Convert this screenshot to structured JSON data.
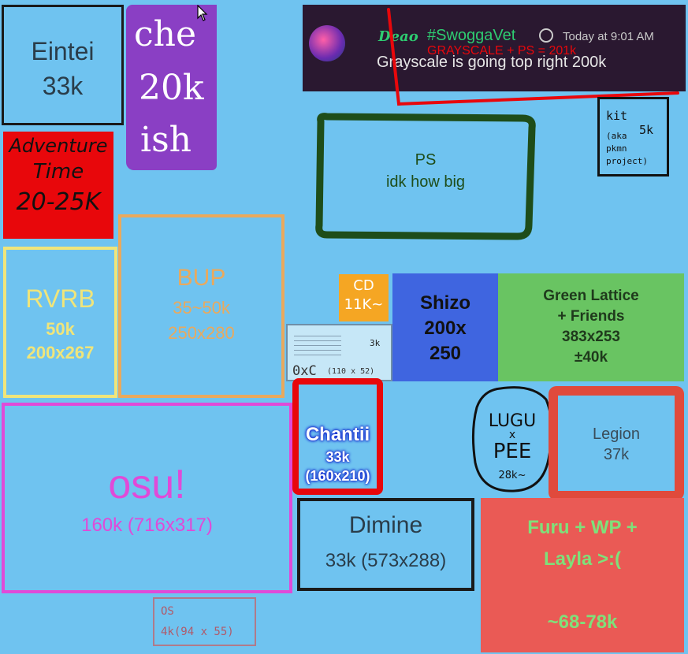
{
  "regions": {
    "eintei": {
      "name": "Eintei",
      "size": "33k"
    },
    "che": {
      "line1": "che",
      "line2": "20k",
      "line3": "ish"
    },
    "adventure": {
      "line1": "Adventure",
      "line2": "Time",
      "line3": "20-25K"
    },
    "rvrb": {
      "name": "RVRB",
      "size": "50k",
      "dims": "200x267"
    },
    "bup": {
      "name": "BUP",
      "size": "35~50k",
      "dims": "250x280"
    },
    "ps": {
      "line1": "PS",
      "line2": "idk how big"
    },
    "kit": {
      "name": "kit",
      "note1": "(aka",
      "note2": "pkmn",
      "note3": "project)",
      "size": "5k"
    },
    "cd": {
      "line1": "CD",
      "line2": "11K~"
    },
    "shizo": {
      "name": "Shizo",
      "dims1": "200x",
      "dims2": "250"
    },
    "green_lattice": {
      "line1": "Green Lattice",
      "line2": "+ Friends",
      "line3": "383x253",
      "line4": "±40k"
    },
    "oxc": {
      "name": "0xC",
      "dims": "(110 x 52)",
      "size": "3k"
    },
    "osu": {
      "name": "osu!",
      "detail": "160k (716x317)"
    },
    "chantii": {
      "name": "Chantii",
      "size": "33k",
      "dims": "(160x210)"
    },
    "lugu": {
      "line1": "LUGU",
      "line2": "x",
      "line3": "PEE",
      "line4": "28k~"
    },
    "legion": {
      "name": "Legion",
      "size": "37k"
    },
    "dimine": {
      "name": "Dimine",
      "detail": "33k (573x288)"
    },
    "furu": {
      "line1": "Furu + WP +",
      "line2": "Layla >:(",
      "line3": "~68-78k"
    },
    "os": {
      "name": "OS",
      "detail": "4k(94 x 55)"
    }
  },
  "message": {
    "username": "Deao",
    "channel": "#SwoggaVet",
    "timestamp": "Today at 9:01 AM",
    "text": "Grayscale is going top right 200k",
    "overlay": "GRAYSCALE + PS = 201k"
  },
  "colors": {
    "background": "#6fc3f0",
    "che": "#8a3fc4",
    "adventure": "#e8070b",
    "rvrb_border": "#f0e57a",
    "bup_border": "#e9a95d",
    "ps_border": "#1e4d1a",
    "osu_border": "#e04ad8",
    "chantii_border": "#e8070b",
    "shizo": "#3f65e0",
    "green_lattice": "#69c462",
    "legion_border": "#e04a3c",
    "furu": "#ea5a55",
    "cd": "#f5a623",
    "discord_bg": "#2a1830"
  }
}
